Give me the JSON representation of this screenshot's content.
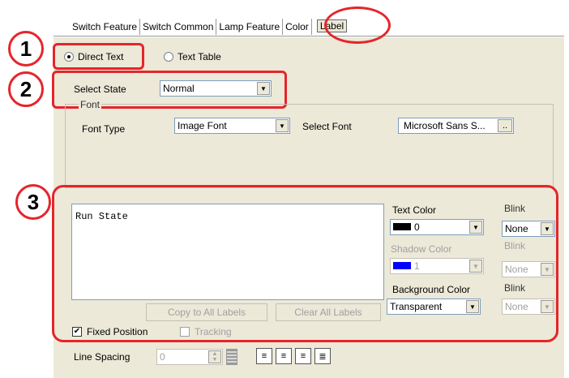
{
  "tabs": [
    {
      "label": "Switch Feature"
    },
    {
      "label": "Switch Common"
    },
    {
      "label": "Lamp Feature"
    },
    {
      "label": "Color"
    },
    {
      "label": "Label"
    }
  ],
  "callouts": {
    "one": "1",
    "two": "2",
    "three": "3"
  },
  "text_source": {
    "direct": "Direct Text",
    "table": "Text Table",
    "selected": "Direct Text"
  },
  "select_state": {
    "label": "Select State",
    "value": "Normal"
  },
  "font": {
    "group_label": "Font",
    "type_label": "Font Type",
    "type_value": "Image Font",
    "select_label": "Select Font",
    "select_value": "Microsoft  Sans S...",
    "browse_label": ".."
  },
  "label_text": "Run State",
  "colors": {
    "text_color_label": "Text Color",
    "text_color_value": "0",
    "text_color_hex": "#000000",
    "shadow_color_label": "Shadow Color",
    "shadow_color_value": "1",
    "shadow_color_hex": "#0000ff",
    "background_color_label": "Background Color",
    "background_color_value": "Transparent",
    "blink_label": "Blink",
    "blink_text_value": "None",
    "blink_shadow_value": "None",
    "blink_background_value": "None"
  },
  "buttons": {
    "copy_all": "Copy to All Labels",
    "clear_all": "Clear All Labels"
  },
  "fixed_position": {
    "label": "Fixed Position",
    "checked": true
  },
  "tracking": {
    "label": "Tracking",
    "checked": false
  },
  "line_spacing": {
    "label": "Line Spacing",
    "value": "0"
  },
  "accent": "#e5252b"
}
